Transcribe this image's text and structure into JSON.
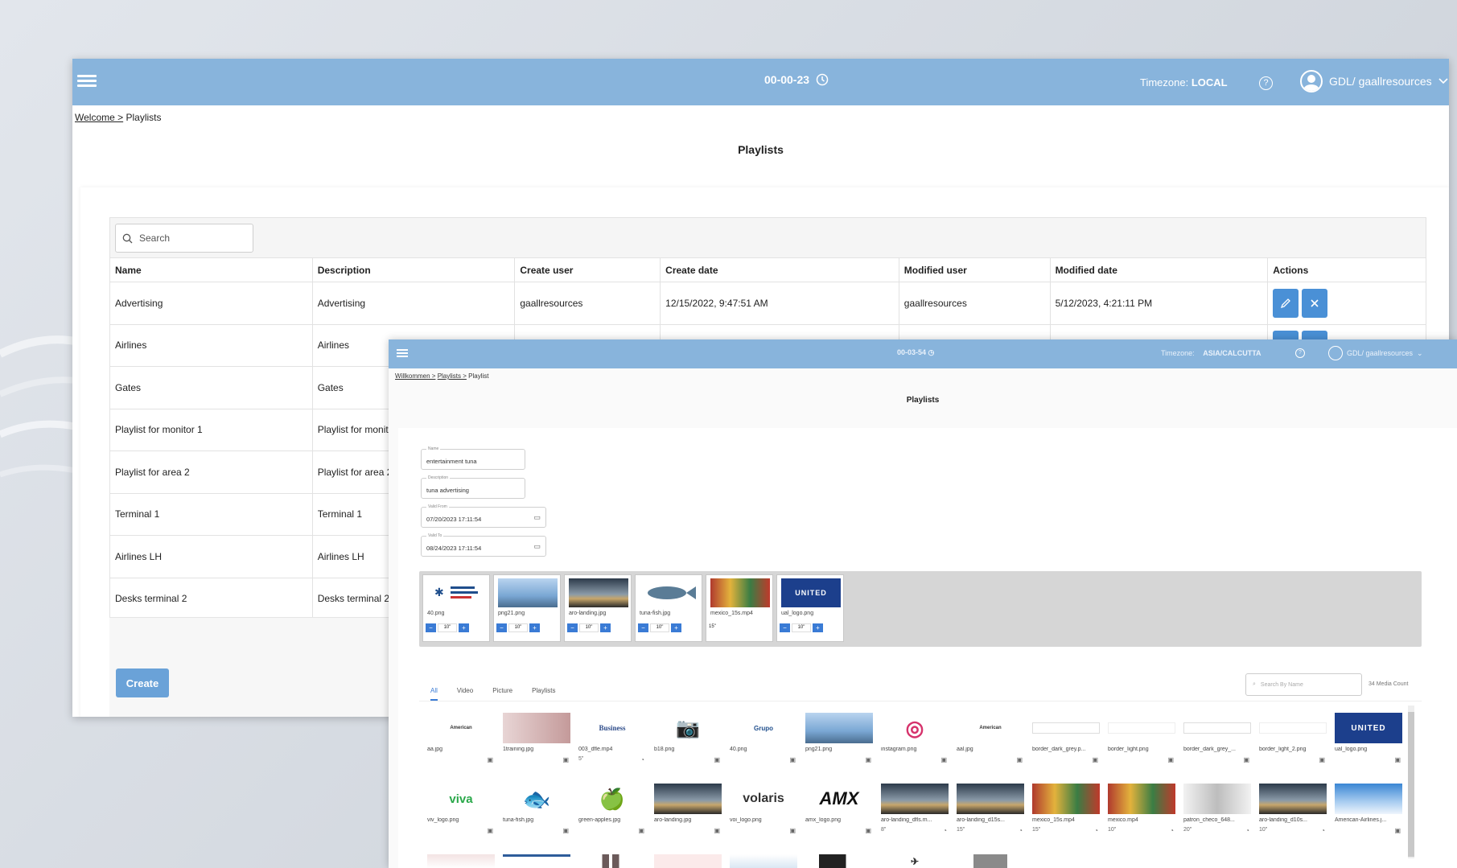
{
  "back": {
    "header": {
      "clock": "00-00-23",
      "tz_label": "Timezone:",
      "tz_value": "LOCAL",
      "help": "?",
      "user": "GDL/ gaallresources"
    },
    "breadcrumb": {
      "home": "Welcome >",
      "current": "Playlists"
    },
    "title": "Playlists",
    "search_placeholder": "Search",
    "columns": [
      "Name",
      "Description",
      "Create user",
      "Create date",
      "Modified user",
      "Modified date",
      "Actions"
    ],
    "rows": [
      {
        "name": "Advertising",
        "desc": "Advertising",
        "cuser": "gaallresources",
        "cdate": "12/15/2022, 9:47:51 AM",
        "muser": "gaallresources",
        "mdate": "5/12/2023, 4:21:11 PM"
      },
      {
        "name": "Airlines",
        "desc": "Airlines"
      },
      {
        "name": "Gates",
        "desc": "Gates"
      },
      {
        "name": "Playlist for monitor 1",
        "desc": "Playlist for monitor 1"
      },
      {
        "name": "Playlist for area 2",
        "desc": "Playlist for area 2"
      },
      {
        "name": "Terminal 1",
        "desc": "Terminal 1"
      },
      {
        "name": "Airlines LH",
        "desc": "Airlines LH"
      },
      {
        "name": "Desks terminal 2",
        "desc": "Desks terminal 2"
      }
    ],
    "create_label": "Create"
  },
  "front": {
    "header": {
      "clock": "00-03-54",
      "tz_label": "Timezone:",
      "tz_value": "ASIA/CALCUTTA",
      "help": "?",
      "user": "GDL/ gaallresources"
    },
    "breadcrumb": {
      "a": "Willkommen >",
      "b": "Playlists >",
      "c": "Playlist"
    },
    "title": "Playlists",
    "fields": {
      "name_label": "Name",
      "name_value": "entertainment tuna",
      "desc_label": "Description",
      "desc_value": "tuna advertising",
      "from_label": "Valid From",
      "from_value": "07/20/2023 17:11:54",
      "to_label": "Valid To",
      "to_value": "08/24/2023 17:11:54"
    },
    "selected": [
      {
        "name": "40.png",
        "dur": "10\""
      },
      {
        "name": "png21.png",
        "dur": "10\""
      },
      {
        "name": "aro-landing.jpg",
        "dur": "10\""
      },
      {
        "name": "tuna-fish.jpg",
        "dur": "10\""
      },
      {
        "name": "mexico_15s.mp4",
        "dur": "15\""
      },
      {
        "name": "ual_logo.png",
        "dur": "10\""
      }
    ],
    "tabs": [
      "All",
      "Video",
      "Picture",
      "Playlists"
    ],
    "search_placeholder": "Search By Name",
    "media_count": "34 Media Count",
    "media_row1": [
      {
        "name": "aa.jpg",
        "thumb": "American"
      },
      {
        "name": "1training.jpg",
        "thumb": ""
      },
      {
        "name": "003_dfle.mp4",
        "thumb": "Business",
        "dur": "5\""
      },
      {
        "name": "b18.png",
        "thumb": "📷"
      },
      {
        "name": "40.png",
        "thumb": "Grupo"
      },
      {
        "name": "png21.png",
        "thumb": ""
      },
      {
        "name": "instagram.png",
        "thumb": "◎"
      },
      {
        "name": "aal.jpg",
        "thumb": "American"
      },
      {
        "name": "border_dark_grey.p...",
        "thumb": ""
      },
      {
        "name": "border_light.png",
        "thumb": ""
      },
      {
        "name": "border_dark_grey_...",
        "thumb": ""
      },
      {
        "name": "border_light_2.png",
        "thumb": ""
      },
      {
        "name": "ual_logo.png",
        "thumb": "UNITED"
      }
    ],
    "media_row2": [
      {
        "name": "viv_logo.png",
        "thumb": "viva"
      },
      {
        "name": "tuna-fish.jpg",
        "thumb": "🐟"
      },
      {
        "name": "green-apples.jpg",
        "thumb": "🍏"
      },
      {
        "name": "aro-landing.jpg",
        "thumb": ""
      },
      {
        "name": "voi_logo.png",
        "thumb": "volaris"
      },
      {
        "name": "amx_logo.png",
        "thumb": "AMX"
      },
      {
        "name": "aro-landing_dfls.m...",
        "thumb": "",
        "dur": "8\""
      },
      {
        "name": "aro-landing_d15s...",
        "thumb": "",
        "dur": "15\""
      },
      {
        "name": "mexico_15s.mp4",
        "thumb": "",
        "dur": "15\""
      },
      {
        "name": "mexico.mp4",
        "thumb": "",
        "dur": "10\""
      },
      {
        "name": "patron_checo_648...",
        "thumb": "",
        "dur": "20\""
      },
      {
        "name": "aro-landing_d10s...",
        "thumb": "",
        "dur": "10\""
      },
      {
        "name": "American-Airlines.j...",
        "thumb": ""
      }
    ]
  },
  "colors": {
    "header": "#88b4dc",
    "accent": "#4a90d6",
    "create": "#6aa2d8"
  },
  "icons": {
    "menu": "hamburger-icon",
    "clock": "clock-icon",
    "help": "help-icon",
    "user": "user-icon",
    "search": "search-icon",
    "edit": "pencil-icon",
    "delete": "close-icon",
    "calendar": "calendar-icon"
  }
}
